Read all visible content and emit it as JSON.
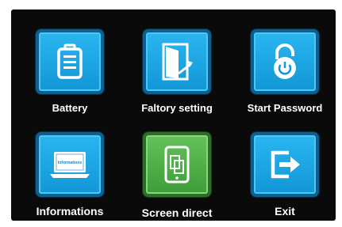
{
  "menu": {
    "items": [
      {
        "id": "battery",
        "label": "Battery",
        "icon": "battery-icon",
        "color": "#1296d6"
      },
      {
        "id": "factory-setting",
        "label": "Faltory setting",
        "icon": "door-exit-icon",
        "color": "#1296d6"
      },
      {
        "id": "start-password",
        "label": "Start Password",
        "icon": "padlock-power-icon",
        "color": "#1296d6"
      },
      {
        "id": "informations",
        "label": "Informations",
        "icon": "laptop-info-icon",
        "screen_text": "Informations",
        "color": "#1296d6"
      },
      {
        "id": "screen-direct",
        "label": "Screen direct",
        "icon": "screen-rotate-icon",
        "color": "#3f9d3a",
        "selected": true
      },
      {
        "id": "exit",
        "label": "Exit",
        "icon": "exit-arrow-icon",
        "color": "#1296d6"
      }
    ]
  }
}
